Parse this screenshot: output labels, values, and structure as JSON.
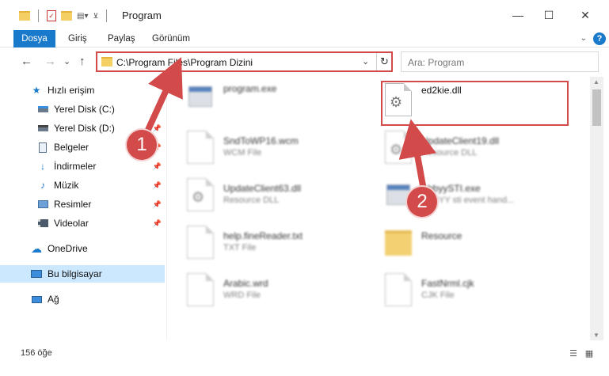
{
  "window": {
    "title": "Program",
    "minimize": "—",
    "maximize": "☐",
    "close": "✕"
  },
  "ribbon": {
    "tabs": [
      "Dosya",
      "Giriş",
      "Paylaş",
      "Görünüm"
    ],
    "help": "?"
  },
  "nav": {
    "back": "←",
    "forward": "→",
    "recent": "⌄",
    "up": "↑",
    "address": "C:\\Program Files\\Program Dizini",
    "refresh": "↻",
    "search_placeholder": "Ara: Program"
  },
  "sidebar": {
    "items": [
      {
        "label": "Hızlı erişim",
        "icon": "star-icon",
        "pinned": false
      },
      {
        "label": "Yerel Disk (C:)",
        "icon": "drive-icon",
        "pinned": true
      },
      {
        "label": "Yerel Disk (D:)",
        "icon": "drive-icon",
        "pinned": true
      },
      {
        "label": "Belgeler",
        "icon": "documents-icon",
        "pinned": true
      },
      {
        "label": "İndirmeler",
        "icon": "download-icon",
        "pinned": true
      },
      {
        "label": "Müzik",
        "icon": "music-icon",
        "pinned": true
      },
      {
        "label": "Resimler",
        "icon": "pictures-icon",
        "pinned": true
      },
      {
        "label": "Videolar",
        "icon": "videos-icon",
        "pinned": true
      },
      {
        "label": "OneDrive",
        "icon": "cloud-icon",
        "pinned": false
      },
      {
        "label": "Bu bilgisayar",
        "icon": "computer-icon",
        "pinned": false,
        "selected": true
      },
      {
        "label": "Ağ",
        "icon": "network-icon",
        "pinned": false
      }
    ]
  },
  "files": [
    {
      "name": "program.exe",
      "type": "",
      "icon": "exe-icon",
      "blurred": true
    },
    {
      "name": "ed2kie.dll",
      "type": "",
      "icon": "dll-icon",
      "blurred": false
    },
    {
      "name": "SndToWP16.wcm",
      "type": "WCM File",
      "icon": "file-icon",
      "blurred": true
    },
    {
      "name": "UpdateClient19.dll",
      "type": "Resource DLL",
      "icon": "dll-icon",
      "blurred": true
    },
    {
      "name": "UpdateClient63.dll",
      "type": "Resource DLL",
      "icon": "dll-icon",
      "blurred": true
    },
    {
      "name": "AbbyySTI.exe",
      "type": "ABBYY sti event hand...",
      "icon": "exe-icon",
      "blurred": true
    },
    {
      "name": "help.fineReader.txt",
      "type": "TXT File",
      "icon": "file-icon",
      "blurred": true
    },
    {
      "name": "Resource",
      "type": "",
      "icon": "folder-icon",
      "blurred": true
    },
    {
      "name": "Arabic.wrd",
      "type": "WRD File",
      "icon": "file-icon",
      "blurred": true
    },
    {
      "name": "FastNrml.cjk",
      "type": "CJK File",
      "icon": "file-icon",
      "blurred": true
    }
  ],
  "annotations": {
    "step1": "1",
    "step2": "2",
    "color": "#d24a4a"
  },
  "status": {
    "item_count": "156 öğe"
  }
}
